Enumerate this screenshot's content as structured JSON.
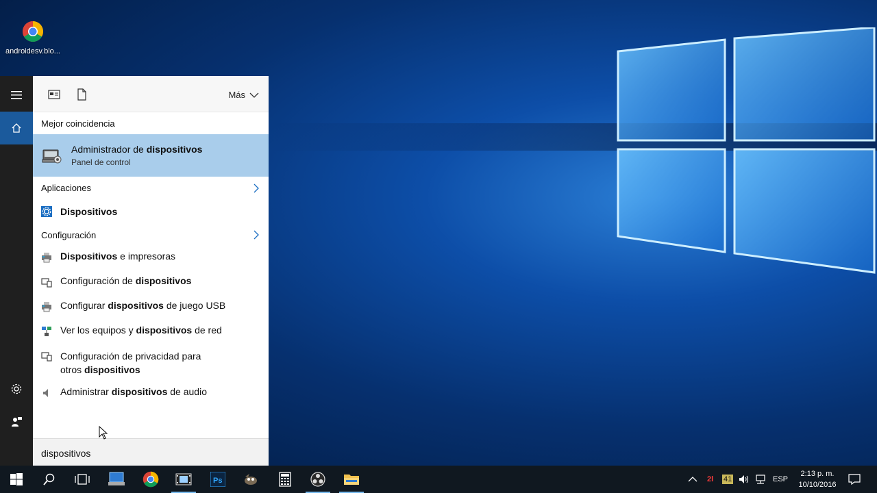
{
  "desktop": {
    "icons": [
      {
        "label": "androidesv.blo..."
      }
    ]
  },
  "search_panel": {
    "toolbar": {
      "more_label": "Más"
    },
    "best_match": {
      "header": "Mejor coincidencia",
      "title_prefix": "Administrador de ",
      "title_bold": "dispositivos",
      "subtitle": "Panel de control"
    },
    "apps": {
      "header": "Aplicaciones",
      "items": [
        {
          "bold": "Dispositivos"
        }
      ]
    },
    "settings": {
      "header": "Configuración",
      "items": [
        {
          "pre": "",
          "bold": "Dispositivos",
          "post": " e impresoras"
        },
        {
          "pre": "Configuración de ",
          "bold": "dispositivos",
          "post": ""
        },
        {
          "pre": "Configurar ",
          "bold": "dispositivos",
          "post": " de juego USB"
        },
        {
          "pre": "Ver los equipos y ",
          "bold": "dispositivos",
          "post": " de red"
        },
        {
          "pre": "Configuración de privacidad para",
          "line2_pre": "otros ",
          "bold": "dispositivos",
          "post": ""
        },
        {
          "pre": "Administrar ",
          "bold": "dispositivos",
          "post": " de audio"
        }
      ]
    },
    "query": "dispositivos"
  },
  "taskbar": {
    "tray": {
      "badge_red": "2l",
      "badge_yellow": "41",
      "language": "ESP",
      "time": "2:13 p. m.",
      "date": "10/10/2016"
    }
  },
  "colors": {
    "highlight": "#a9cdeb",
    "rail": "#1f1f1f",
    "rail_active": "#1b5a9c",
    "taskbar": "#101820"
  }
}
